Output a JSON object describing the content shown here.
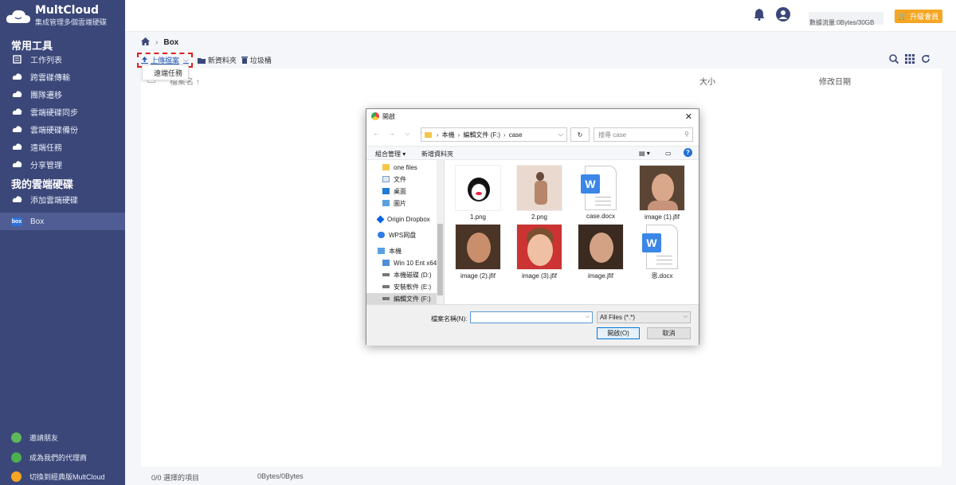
{
  "app": {
    "name": "MultCloud",
    "tagline": "集成管理多個雲端硬碟"
  },
  "sidebar": {
    "section_common": "常用工具",
    "common_items": [
      {
        "label": "工作列表",
        "icon": "task-list-icon"
      },
      {
        "label": "跨雲碟傳輸",
        "icon": "cloud-transfer-icon"
      },
      {
        "label": "團隊遷移",
        "icon": "team-migrate-icon"
      },
      {
        "label": "雲端硬碟同步",
        "icon": "cloud-sync-icon"
      },
      {
        "label": "雲端硬碟備份",
        "icon": "cloud-backup-icon"
      },
      {
        "label": "遠端任務",
        "icon": "remote-task-icon"
      },
      {
        "label": "分享管理",
        "icon": "share-icon"
      }
    ],
    "section_my": "我的雲端硬碟",
    "add_cloud": "添加雲端硬碟",
    "box_item": "Box",
    "bottom_items": [
      {
        "label": "邀請朋友",
        "color": "#5fb85a"
      },
      {
        "label": "成為我們的代理商",
        "color": "#4caf50"
      },
      {
        "label": "切換到經典版MultCloud",
        "color": "#f5a623"
      }
    ]
  },
  "topbar": {
    "traffic": "數據流量:0Bytes/30GB",
    "upgrade": "升級會員"
  },
  "breadcrumb": {
    "current": "Box"
  },
  "toolbar": {
    "upload": "上傳檔案",
    "new_folder": "新資料夾",
    "trash": "垃圾桶",
    "dropdown_item": "遠端任務"
  },
  "table": {
    "col_name": "檔案名",
    "col_size": "大小",
    "col_date": "修改日期"
  },
  "status": {
    "selected": "0/0 選擇的項目",
    "size": "0Bytes/0Bytes"
  },
  "dialog": {
    "title": "開啟",
    "path": [
      "本機",
      "編輯文件 (F:)",
      "case"
    ],
    "search_placeholder": "搜尋 case",
    "organize": "組合管理",
    "new_folder": "新增資料夾",
    "nav": [
      {
        "label": "one files",
        "icon": "folder-icon"
      },
      {
        "label": "文件",
        "icon": "documents-icon"
      },
      {
        "label": "桌面",
        "icon": "desktop-icon"
      },
      {
        "label": "圖片",
        "icon": "pictures-icon"
      },
      {
        "label": "Origin Dropbox",
        "icon": "dropbox-icon"
      },
      {
        "label": "WPS网盘",
        "icon": "wps-icon"
      },
      {
        "label": "本機",
        "icon": "computer-icon"
      },
      {
        "label": "Win 10 Ent x64",
        "icon": "drive-icon"
      },
      {
        "label": "本機磁碟 (D:)",
        "icon": "drive-icon"
      },
      {
        "label": "安裝軟件 (E:)",
        "icon": "drive-icon"
      },
      {
        "label": "編輯文件 (F:)",
        "icon": "drive-icon"
      }
    ],
    "files": [
      "1.png",
      "2.png",
      "case.docx",
      "image (1).jfif",
      "image (2).jfif",
      "image (3).jfif",
      "image.jfif",
      "恩.docx"
    ],
    "filename_label": "檔案名稱(N):",
    "filetype": "All Files (*.*)",
    "open_btn": "開啟(O)",
    "cancel_btn": "取消"
  }
}
